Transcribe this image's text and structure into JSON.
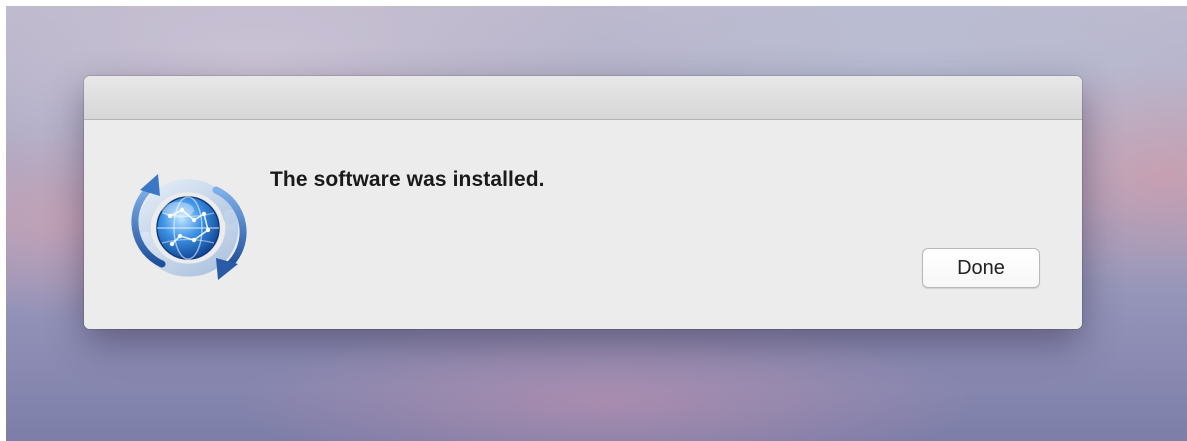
{
  "dialog": {
    "message": "The software was installed.",
    "done_label": "Done",
    "icon": "software-update-icon"
  },
  "colors": {
    "dialog_background": "#ececec",
    "titlebar": "#dcdcdc",
    "globe_blue": "#2e7fd6",
    "arrow_blue": "#2f67b4"
  }
}
